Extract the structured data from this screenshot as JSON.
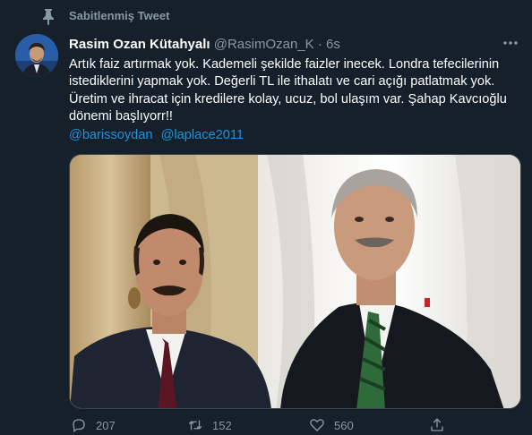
{
  "pinned": {
    "label": "Sabitlenmiş Tweet",
    "icon": "pin-icon"
  },
  "tweet": {
    "author_name": "Rasim Ozan Kütahyalı",
    "handle": "@RasimOzan_K",
    "separator": "·",
    "time": "6s",
    "text": "Artık faiz artırmak yok. Kademeli şekilde faizler inecek. Londra tefecilerinin istediklerini yapmak yok. Değerli TL ile ithalatı ve cari açığı patlatmak yok. Üretim ve ihracat için kredilere kolay, ucuz, bol ulaşım var. Şahap Kavcıoğlu dönemi başlıyorr!!",
    "mentions": [
      "@barissoydan",
      "@laplace2011"
    ],
    "media_icon": "photo-of-two-men"
  },
  "actions": {
    "reply_count": "207",
    "retweet_count": "152",
    "like_count": "560"
  },
  "colors": {
    "background": "#15202b",
    "secondary_text": "#8899a6",
    "link": "#1b95e0"
  }
}
